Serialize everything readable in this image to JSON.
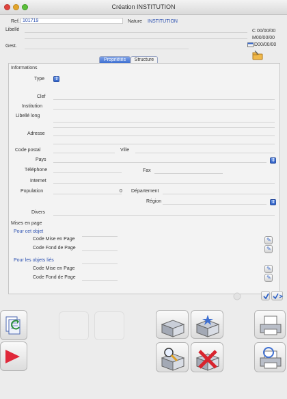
{
  "window": {
    "title": "Création INSTITUTION"
  },
  "header": {
    "ref_label": "Ref.",
    "ref_value": "101719",
    "nature_label": "Nature",
    "nature_value": "INSTITUTION",
    "libelle_label": "Libellé",
    "gest_label": "Gest.",
    "dates": [
      "C 00/00/00",
      "M00/00/00",
      "D00/00/00"
    ]
  },
  "tabs": [
    {
      "label": "Propriétés",
      "active": true
    },
    {
      "label": "Structure",
      "active": false
    }
  ],
  "form": {
    "section_informations": "Informations",
    "type_label": "Type",
    "clef_label": "Clef",
    "institution_label": "Institution",
    "libelle_long_label": "Libellé long",
    "adresse_label": "Adresse",
    "code_postal_label": "Code postal",
    "ville_label": "Ville",
    "pays_label": "Pays",
    "telephone_label": "Téléphone",
    "fax_label": "Fax",
    "internet_label": "Internet",
    "population_label": "Population",
    "population_value": "0",
    "departement_label": "Département",
    "region_label": "Région",
    "divers_label": "Divers"
  },
  "mises_en_page": {
    "title": "Mises en page",
    "cet_objet": "Pour cet objet",
    "objets_lies": "Pour les objets liés",
    "code_mise_en_page": "Code Mise en Page",
    "code_fond_de_page": "Code Fond de Page"
  },
  "icons": {
    "accent": "#3e6fd1",
    "red_arrow": "#e0283a",
    "delete_red": "#d8242e"
  }
}
